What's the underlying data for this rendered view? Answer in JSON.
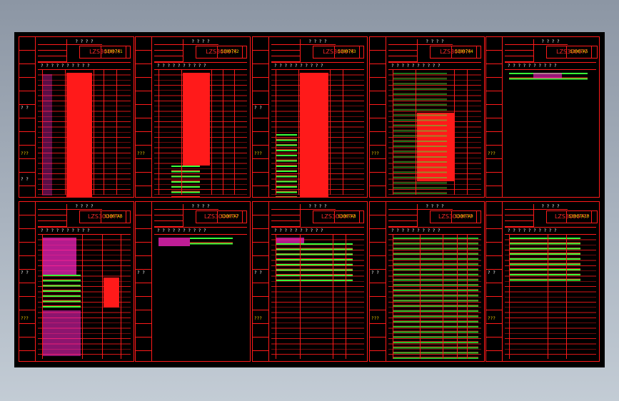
{
  "colors": {
    "frame_red": "#ff1a1a",
    "text_magenta": "#ff3fd6",
    "text_green": "#3cff3c",
    "text_yellow": "#ffe600",
    "background": "#000000"
  },
  "sheets": [
    {
      "id": "s1",
      "title": "LZS3000??",
      "code": "S3007A1"
    },
    {
      "id": "s2",
      "title": "LZS3000??",
      "code": "S3007A2"
    },
    {
      "id": "s3",
      "title": "LZS3000??",
      "code": "S3007A3"
    },
    {
      "id": "s4",
      "title": "LZS3000??",
      "code": "S3007A4"
    },
    {
      "id": "s5",
      "title": "LZS3000??",
      "code": "S3007A5"
    },
    {
      "id": "s6",
      "title": "LZS3000???",
      "code": "S3007A6"
    },
    {
      "id": "s7",
      "title": "LZS3000???",
      "code": "S3007A7"
    },
    {
      "id": "s8",
      "title": "LZS3000???",
      "code": "S3007A8"
    },
    {
      "id": "s9",
      "title": "LZS3000???",
      "code": "S3007A9"
    },
    {
      "id": "s10",
      "title": "LZS3000???",
      "code": "S3007A10"
    }
  ],
  "labels": {
    "header_marks": "? ? ? ?",
    "column_header": "? ?   ? ?   ? ? ? ?   ? ?",
    "side_a": "? ?",
    "side_b": "???",
    "side_c": "? ?"
  }
}
